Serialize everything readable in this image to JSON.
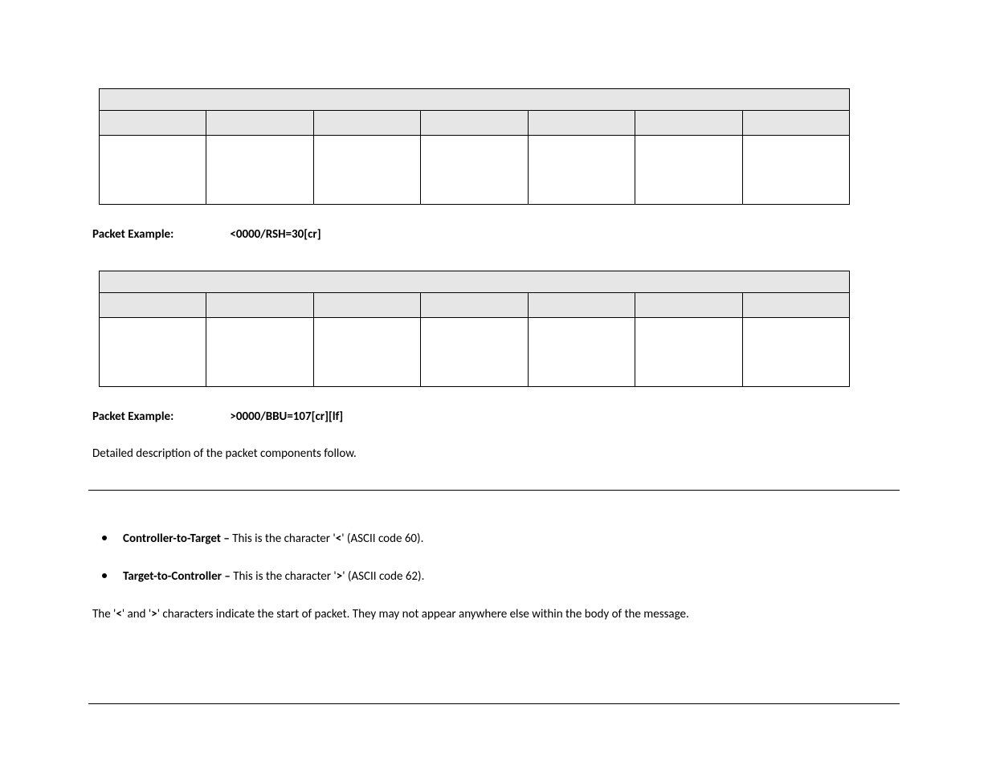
{
  "example1": {
    "label": "Packet Example:",
    "value": "<0000/RSH=30[cr]"
  },
  "example2": {
    "label": "Packet Example:",
    "value": ">0000/BBU=107[cr][lf]"
  },
  "description": "Detailed description of the packet components follow.",
  "bullets": [
    {
      "bold": "Controller-to-Target – ",
      "pre": "This is the character '",
      "char": "<",
      "post": "' (ASCII code 60)."
    },
    {
      "bold": "Target-to-Controller – ",
      "pre": "This is the character '",
      "char": ">",
      "post": "' (ASCII code 62)."
    }
  ],
  "closing": {
    "p1": "The '",
    "c1": "<",
    "p2": "' and '",
    "c2": ">",
    "p3": "' characters indicate the start of packet. They may not appear anywhere else within the body of the message."
  }
}
